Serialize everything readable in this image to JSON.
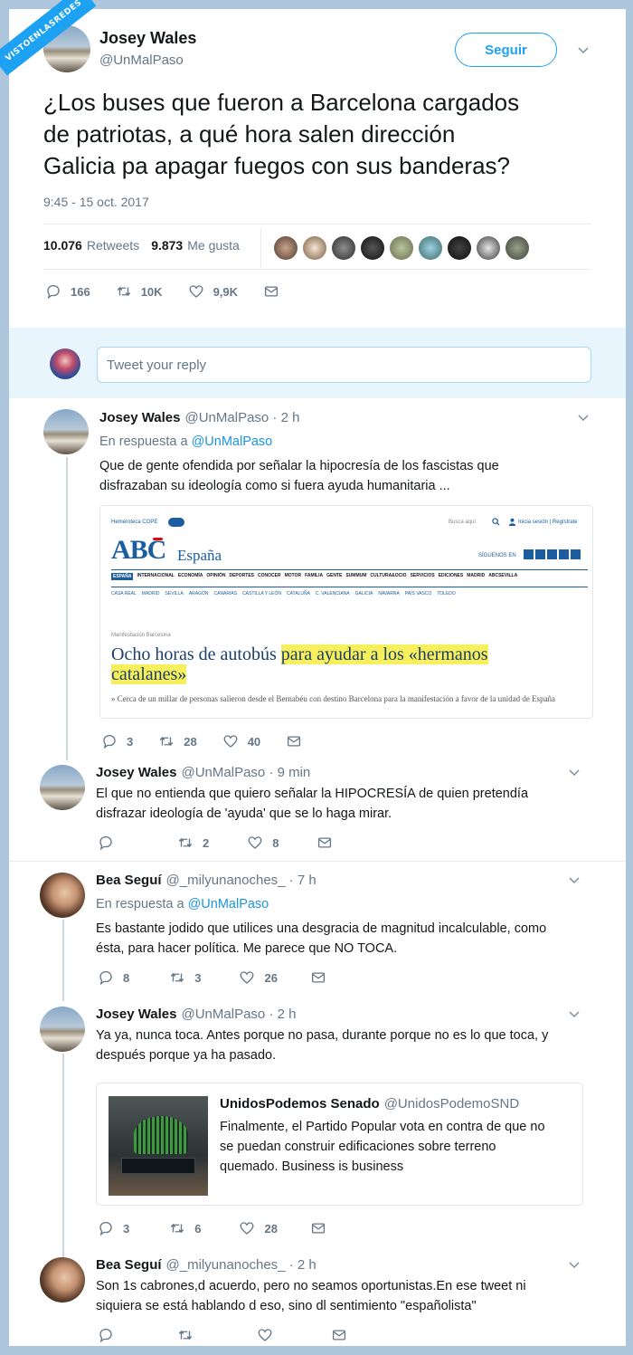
{
  "watermark": "VISTOENLASREDES",
  "main": {
    "name": "Josey Wales",
    "handle": "@UnMalPaso",
    "follow": "Seguir",
    "text_lines": [
      "¿Los buses que fueron a Barcelona cargados",
      "de patriotas, a qué hora salen dirección",
      "Galicia pa apagar fuegos con sus banderas?"
    ],
    "timestamp": "9:45 - 15 oct. 2017",
    "retweets_count": "10.076",
    "retweets_label": "Retweets",
    "likes_count": "9.873",
    "likes_label": "Me gusta",
    "replies": "166",
    "rts": "10K",
    "likes": "9,9K"
  },
  "reply_box": {
    "placeholder": "Tweet your reply"
  },
  "replies": [
    {
      "name": "Josey Wales",
      "handle": "@UnMalPaso · 2 h",
      "reply_to": "En respuesta a",
      "reply_to_handle": "@UnMalPaso",
      "lines": [
        "Que de gente ofendida por señalar la hipocresía de los fascistas que",
        "disfrazaban su ideología como si fuera ayuda humanitaria ..."
      ],
      "replies": "3",
      "rts": "28",
      "likes": "40"
    },
    {
      "name": "Josey Wales",
      "handle": "@UnMalPaso · 9 min",
      "lines": [
        "El que no entienda que quiero señalar la HIPOCRESÍA de quien pretendía",
        "disfrazar ideología de 'ayuda' que se lo haga mirar."
      ],
      "replies": "",
      "rts": "2",
      "likes": "8"
    },
    {
      "name": "Bea Seguí",
      "handle": "@_milyunanoches_ · 7 h",
      "reply_to": "En respuesta a",
      "reply_to_handle": "@UnMalPaso",
      "lines": [
        "Es bastante jodido que utilices una desgracia de magnitud incalculable, como",
        "ésta, para hacer política. Me parece que NO TOCA."
      ],
      "replies": "8",
      "rts": "3",
      "likes": "26"
    },
    {
      "name": "Josey Wales",
      "handle": "@UnMalPaso · 2 h",
      "lines": [
        "Ya ya, nunca toca. Antes porque no pasa, durante porque no es lo que toca, y",
        "después porque ya ha pasado."
      ],
      "replies": "3",
      "rts": "6",
      "likes": "28"
    },
    {
      "name": "Bea Seguí",
      "handle": "@_milyunanoches_ · 2 h",
      "lines": [
        "Son 1s cabrones,d acuerdo, pero no seamos oportunistas.En ese tweet ni",
        "siquiera se está hablando d eso, sino dl sentimiento \"españolista\""
      ],
      "replies": "",
      "rts": "",
      "likes": ""
    }
  ],
  "abc": {
    "top_left": "Hemeroteca COPE",
    "top_right_search": "Busca aquí",
    "login": "Inicia sesión | Regístrate",
    "logo": "ABC",
    "section": "España",
    "follow": "SÍGUENOS EN",
    "nav": [
      "ESPAÑA",
      "INTERNACIONAL",
      "ECONOMÍA",
      "OPINIÓN",
      "DEPORTES",
      "CONOCER",
      "MOTOR",
      "FAMILIA",
      "GENTE",
      "SUMMUM",
      "CULTURA&OCIO",
      "SERVICIOS",
      "EDICIONES",
      "MADRID",
      "ABCSEVILLA"
    ],
    "subnav": [
      "CASA REAL",
      "MADRID",
      "SEVILLA",
      "ARAGÓN",
      "CANARIAS",
      "CASTILLA Y LEÓN",
      "CATALUÑA",
      "C. VALENCIANA",
      "GALICIA",
      "NAVARRA",
      "PAÍS VASCO",
      "TOLEDO"
    ],
    "kicker": "Manifestación Barcelona",
    "headline_a": "Ocho horas de autobús ",
    "headline_b": "para ayudar a los «hermanos",
    "headline_c": "catalanes»",
    "summary": "Cerca de un millar de personas salieron desde el Bernabéu con destino Barcelona para la manifestación a favor de la unidad de España"
  },
  "quoted": {
    "name": "UnidosPodemos Senado",
    "handle": "@UnidosPodemoSND",
    "lines": [
      "Finalmente, el Partido Popular vota en contra de que no",
      "se puedan construir edificaciones sobre terreno",
      "quemado. Business is business"
    ]
  },
  "colors": {
    "accent": "#1da1f2",
    "link": "#1b95e0",
    "muted": "#657786",
    "highlight": "#f7ef5b"
  }
}
